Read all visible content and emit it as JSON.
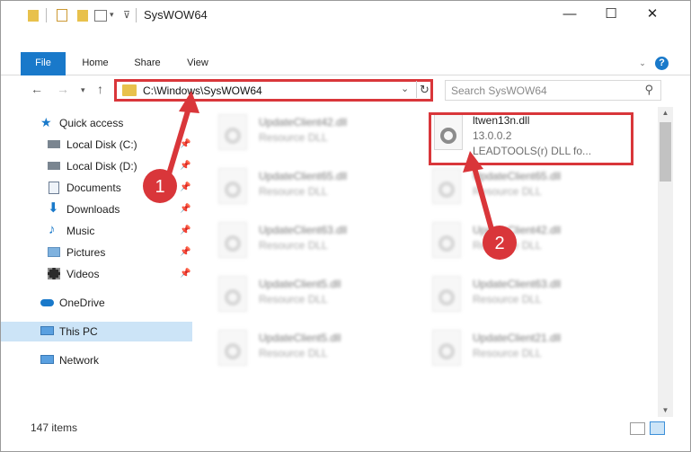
{
  "window": {
    "title": "SysWOW64",
    "controls": {
      "minimize": "—",
      "maximize": "☐",
      "close": "✕"
    }
  },
  "ribbon": {
    "tabs": [
      "File",
      "Home",
      "Share",
      "View"
    ],
    "help": "?"
  },
  "address": {
    "path": "C:\\Windows\\SysWOW64",
    "search_placeholder": "Search SysWOW64"
  },
  "nav": {
    "items": [
      {
        "label": "Quick access",
        "icon": "star-icon"
      },
      {
        "label": "Local Disk (C:)",
        "icon": "drive-icon",
        "pinned": true
      },
      {
        "label": "Local Disk (D:)",
        "icon": "drive-icon",
        "pinned": true
      },
      {
        "label": "Documents",
        "icon": "documents-icon",
        "pinned": true
      },
      {
        "label": "Downloads",
        "icon": "download-icon",
        "pinned": true
      },
      {
        "label": "Music",
        "icon": "music-icon",
        "pinned": true
      },
      {
        "label": "Pictures",
        "icon": "pictures-icon",
        "pinned": true
      },
      {
        "label": "Videos",
        "icon": "videos-icon",
        "pinned": true
      },
      {
        "label": "OneDrive",
        "icon": "cloud-icon"
      },
      {
        "label": "This PC",
        "icon": "pc-icon",
        "selected": true
      },
      {
        "label": "Network",
        "icon": "network-icon"
      }
    ]
  },
  "files": {
    "left": [
      {
        "name": "UpdateClient42.dll",
        "desc": "Resource DLL"
      },
      {
        "name": "UpdateClient65.dll",
        "desc": "Resource DLL"
      },
      {
        "name": "UpdateClient63.dll",
        "desc": "Resource DLL"
      },
      {
        "name": "UpdateClient5.dll",
        "desc": "Resource DLL"
      },
      {
        "name": "UpdateClient5.dll",
        "desc": "Resource DLL"
      }
    ],
    "right": [
      {
        "name": "ltwen13n.dll",
        "version": "13.0.0.2",
        "desc": "LEADTOOLS(r) DLL fo..."
      },
      {
        "name": "UpdateClient65.dll",
        "desc": "Resource DLL"
      },
      {
        "name": "UpdateClient42.dll",
        "desc": "Resource DLL"
      },
      {
        "name": "UpdateClient63.dll",
        "desc": "Resource DLL"
      },
      {
        "name": "UpdateClient21.dll",
        "desc": "Resource DLL"
      }
    ]
  },
  "status": {
    "count": "147 items"
  },
  "annotations": {
    "step1": "1",
    "step2": "2",
    "color": "#d9363a"
  }
}
